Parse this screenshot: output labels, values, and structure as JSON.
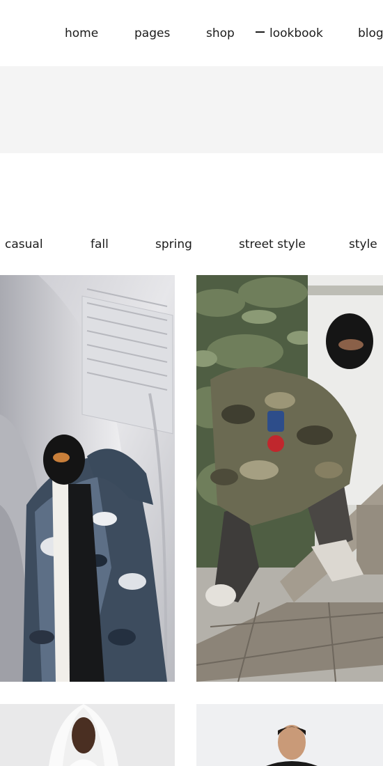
{
  "nav": {
    "items": [
      {
        "label": "home"
      },
      {
        "label": "pages"
      },
      {
        "label": "shop"
      },
      {
        "label": "lookbook",
        "active": true
      },
      {
        "label": "blog"
      }
    ]
  },
  "filters": {
    "items": [
      {
        "label": "casual"
      },
      {
        "label": "fall"
      },
      {
        "label": "spring"
      },
      {
        "label": "street style"
      },
      {
        "label": "style"
      }
    ]
  },
  "colors": {
    "text": "#1b1b1b",
    "band": "#f4f4f4",
    "background": "#ffffff"
  }
}
